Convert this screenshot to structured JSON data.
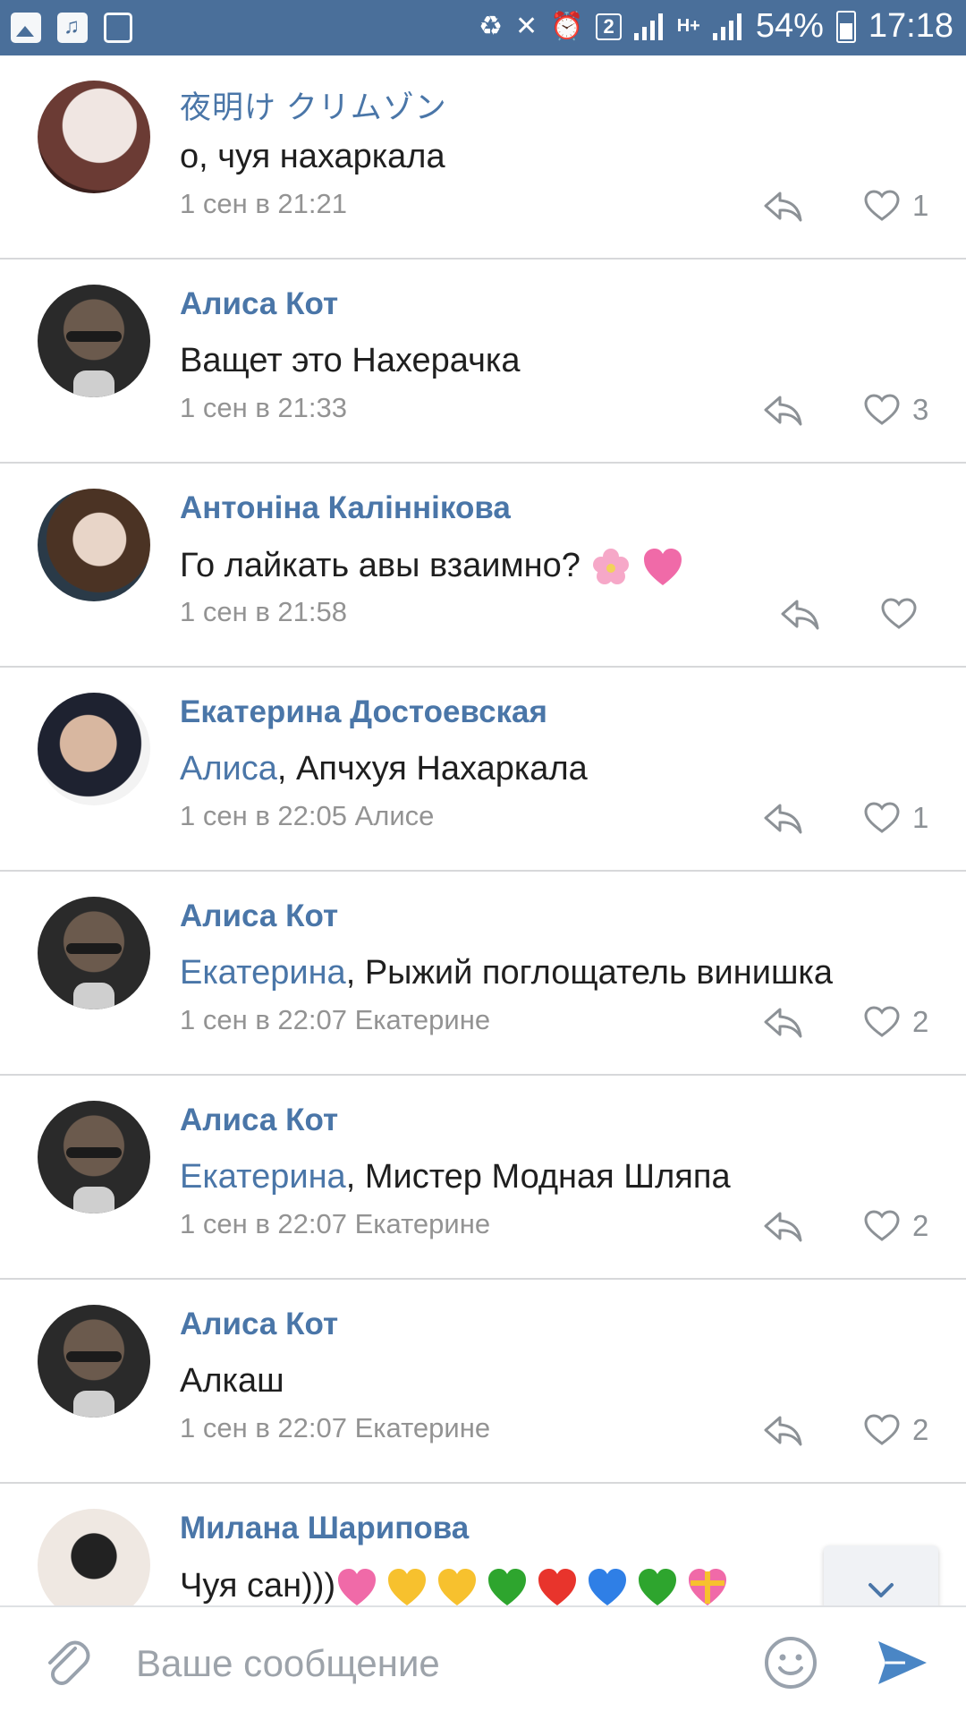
{
  "status_bar": {
    "sim": "2",
    "network": "H+",
    "battery": "54%",
    "time": "17:18"
  },
  "comments": [
    {
      "name": "夜明け クリムゾン",
      "text": "о, чуя нахаркала",
      "mention": "",
      "date": "1 сен в 21:21",
      "likes": "1"
    },
    {
      "name": "Алиса Кот",
      "text": "Ващет это Нахерачка",
      "mention": "",
      "date": "1 сен в 21:33",
      "likes": "3"
    },
    {
      "name": "Антоніна Каліннікова",
      "text": "Го лайкать авы взаимно?",
      "mention": "",
      "date": "1 сен в 21:58",
      "likes": ""
    },
    {
      "name": "Екатерина Достоевская",
      "text": ", Апчхуя Нахаркала",
      "mention": "Алиса",
      "date": "1 сен в 22:05 Алисе",
      "likes": "1"
    },
    {
      "name": "Алиса Кот",
      "text": ", Рыжий поглощатель винишка",
      "mention": "Екатерина",
      "date": "1 сен в 22:07 Екатерине",
      "likes": "2"
    },
    {
      "name": "Алиса Кот",
      "text": ", Мистер Модная Шляпа",
      "mention": "Екатерина",
      "date": "1 сен в 22:07 Екатерине",
      "likes": "2"
    },
    {
      "name": "Алиса Кот",
      "text": "Алкаш",
      "mention": "",
      "date": "1 сен в 22:07 Екатерине",
      "likes": "2"
    },
    {
      "name": "Милана Шарипова",
      "text": "Чуя сан)))",
      "mention": "",
      "date": "",
      "likes": ""
    }
  ],
  "composer": {
    "placeholder": "Ваше сообщение"
  },
  "icons": [
    "image-icon",
    "music-icon",
    "screen-record-icon",
    "sync-icon",
    "mute-icon",
    "alarm-icon",
    "signal-icon",
    "battery-icon",
    "reply-icon",
    "heart-icon",
    "chevron-down-icon",
    "paperclip-icon",
    "smile-icon",
    "send-icon"
  ],
  "colors": {
    "status_bar": "#4a6f9a",
    "link": "#4a76a8",
    "meta": "#939393",
    "send": "#4a86c5"
  }
}
